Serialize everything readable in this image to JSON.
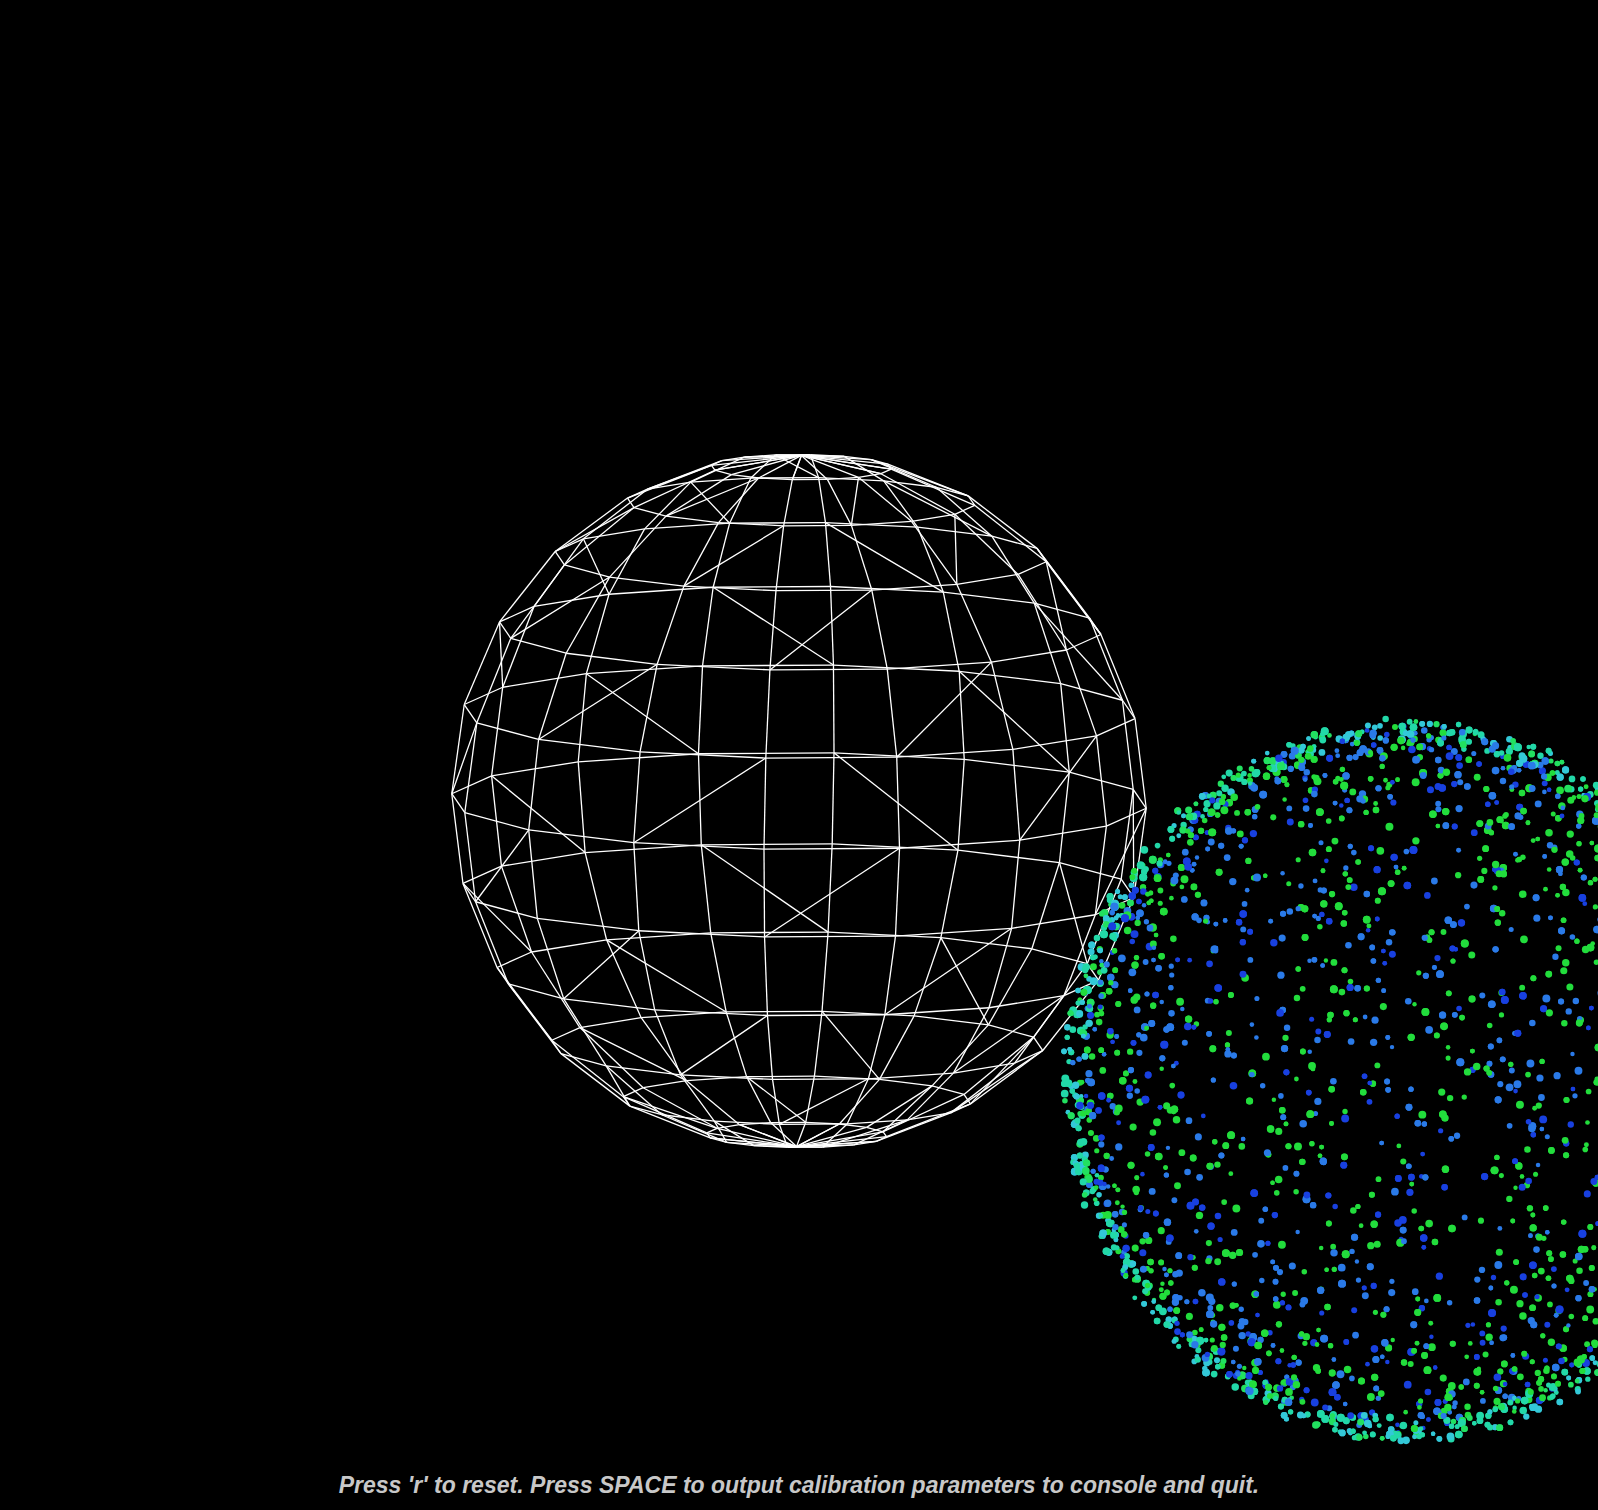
{
  "hint": {
    "text": "Press 'r' to reset. Press SPACE to output calibration parameters to console and quit."
  }
}
